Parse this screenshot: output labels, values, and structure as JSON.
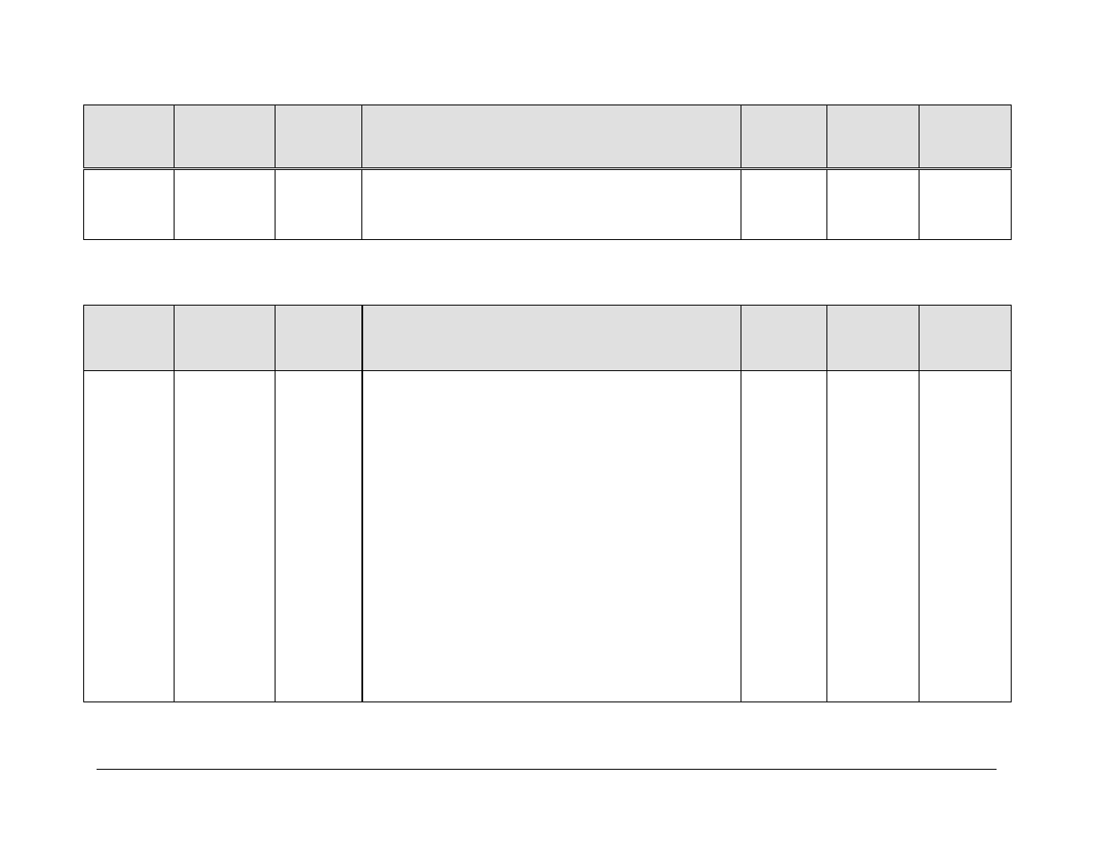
{
  "table1": {
    "headers": [
      "",
      "",
      "",
      "",
      "",
      "",
      ""
    ],
    "rows": [
      [
        "",
        "",
        "",
        "",
        "",
        "",
        ""
      ]
    ]
  },
  "table2": {
    "headers": [
      "",
      "",
      "",
      "",
      "",
      "",
      ""
    ],
    "rows": [
      [
        "",
        "",
        "",
        "",
        "",
        "",
        ""
      ]
    ]
  }
}
